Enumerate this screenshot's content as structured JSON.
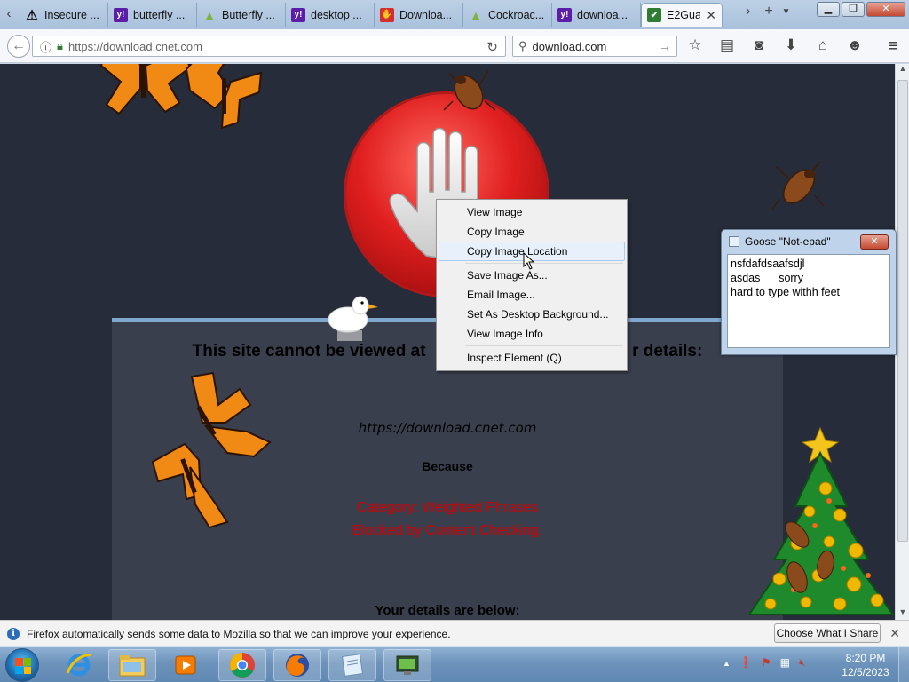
{
  "browser": {
    "tabs": [
      {
        "label": "Insecure ...",
        "icon": "warning-icon"
      },
      {
        "label": "butterfly ...",
        "icon": "yahoo-icon"
      },
      {
        "label": "Butterfly ...",
        "icon": "android-icon"
      },
      {
        "label": "desktop ...",
        "icon": "yahoo-icon"
      },
      {
        "label": "Downloa...",
        "icon": "blocked-page-icon"
      },
      {
        "label": "Cockroac...",
        "icon": "android-icon"
      },
      {
        "label": "downloa...",
        "icon": "yahoo-icon"
      },
      {
        "label": "E2Gua...",
        "icon": "shield-icon",
        "active": true
      }
    ],
    "url": "https://download.cnet.com",
    "search_value": "download.com"
  },
  "page": {
    "heading_left": "This site cannot be viewed at",
    "heading_right": "r details:",
    "blocked_url": "https://download.cnet.com",
    "because": "Because",
    "category_line1": "Category: Weighted Phrases",
    "category_line2": "Blocked by Content Checking.",
    "details_heading": "Your details are below:"
  },
  "context_menu": {
    "items": [
      {
        "label": "View Image"
      },
      {
        "label": "Copy Image"
      },
      {
        "label": "Copy Image Location",
        "highlighted": true
      },
      {
        "separator": true
      },
      {
        "label": "Save Image As..."
      },
      {
        "label": "Email Image..."
      },
      {
        "label": "Set As Desktop Background..."
      },
      {
        "label": "View Image Info"
      },
      {
        "separator": true
      },
      {
        "label": "Inspect Element (Q)"
      }
    ]
  },
  "notepad": {
    "title": "Goose \"Not-epad\"",
    "content": "nsfdafdsaafsdjl\nasdas      sorry\nhard to type withh feet"
  },
  "notification": {
    "message": "Firefox automatically sends some data to Mozilla so that we can improve your experience.",
    "button": "Choose What I Share"
  },
  "taskbar": {
    "time": "8:20 PM",
    "date": "12/5/2023",
    "pinned": [
      "internet-explorer",
      "file-explorer",
      "media-player",
      "chrome",
      "firefox",
      "notepad",
      "network-app"
    ]
  },
  "colors": {
    "page_background": "#272c3a",
    "panel_background": "#3a3f4e",
    "category_text": "#d40000",
    "stop_sign": "#e01f1f"
  }
}
